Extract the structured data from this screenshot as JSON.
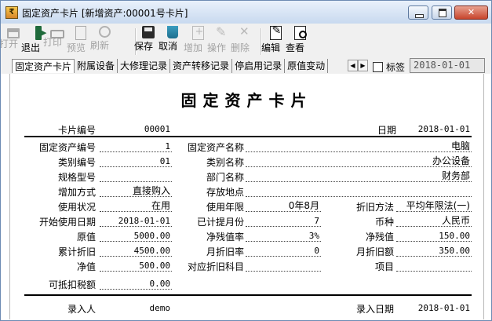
{
  "window": {
    "title": "固定资产卡片 [新增资产:00001号卡片]"
  },
  "toolbar": {
    "open": "打开",
    "exit": "退出",
    "print": "打印",
    "preview": "预览",
    "refresh": "刷新",
    "save": "保存",
    "cancel": "取消",
    "add": "增加",
    "operate": "操作",
    "delete": "删除",
    "edit": "编辑",
    "view": "查看"
  },
  "tabs": [
    "固定资产卡片",
    "附属设备",
    "大修理记录",
    "资产转移记录",
    "停启用记录",
    "原值变动"
  ],
  "tab_scroll": {
    "left": "◀",
    "right": "▶"
  },
  "tag_checkbox": {
    "label": "标签",
    "checked": false
  },
  "date_field": {
    "value": "2018-01-01"
  },
  "card": {
    "title": "固定资产卡片",
    "header": {
      "card_no_label": "卡片编号",
      "card_no": "00001",
      "date_label": "日期",
      "date": "2018-01-01"
    },
    "fields": {
      "asset_no_label": "固定资产编号",
      "asset_no": "1",
      "asset_name_label": "固定资产名称",
      "asset_name": "电脑",
      "category_no_label": "类别编号",
      "category_no": "01",
      "category_name_label": "类别名称",
      "category_name": "办公设备",
      "spec_label": "规格型号",
      "spec": "",
      "dept_label": "部门名称",
      "dept": "财务部",
      "add_method_label": "增加方式",
      "add_method": "直接购入",
      "location_label": "存放地点",
      "location": "",
      "status_label": "使用状况",
      "status": "在用",
      "life_label": "使用年限",
      "life": "0年8月",
      "dep_method_label": "折旧方法",
      "dep_method": "平均年限法(一)",
      "start_date_label": "开始使用日期",
      "start_date": "2018-01-01",
      "accrued_months_label": "已计提月份",
      "accrued_months": "7",
      "currency_label": "币种",
      "currency": "人民币",
      "original_value_label": "原值",
      "original_value": "5000.00",
      "salvage_rate_label": "净残值率",
      "salvage_rate": "3%",
      "salvage_label": "净残值",
      "salvage": "150.00",
      "acc_dep_label": "累计折旧",
      "acc_dep": "4500.00",
      "monthly_rate_label": "月折旧率",
      "monthly_rate": "0",
      "monthly_amount_label": "月折旧额",
      "monthly_amount": "350.00",
      "net_value_label": "净值",
      "net_value": "500.00",
      "dep_subject_label": "对应折旧科目",
      "dep_subject": "",
      "project_label": "项目",
      "project": "",
      "deductible_tax_label": "可抵扣税额",
      "deductible_tax": "0.00"
    },
    "footer": {
      "entered_by_label": "录入人",
      "entered_by": "demo",
      "entry_date_label": "录入日期",
      "entry_date": "2018-01-01"
    }
  }
}
